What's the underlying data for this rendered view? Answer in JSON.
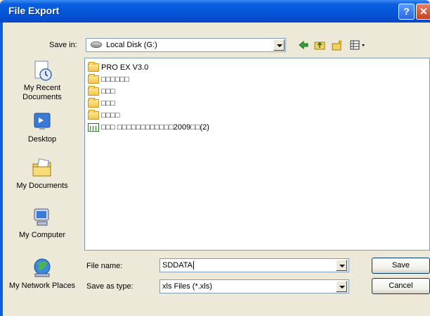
{
  "window": {
    "title": "File Export"
  },
  "toolbar": {
    "save_in_label": "Save in:",
    "location": "Local Disk (G:)"
  },
  "places": [
    {
      "label": "My Recent Documents",
      "icon": "recent-documents-icon"
    },
    {
      "label": "Desktop",
      "icon": "desktop-icon"
    },
    {
      "label": "My Documents",
      "icon": "my-documents-icon"
    },
    {
      "label": "My Computer",
      "icon": "my-computer-icon"
    },
    {
      "label": "My Network Places",
      "icon": "network-places-icon"
    }
  ],
  "files": [
    {
      "name": "PRO EX V3.0",
      "type": "folder"
    },
    {
      "name": "□□□□□□",
      "type": "folder"
    },
    {
      "name": "□□□",
      "type": "folder"
    },
    {
      "name": "□□□",
      "type": "folder"
    },
    {
      "name": "□□□□",
      "type": "folder"
    },
    {
      "name": "□□□ □□□□□□□□□□□□2009□□(2)",
      "type": "xls"
    }
  ],
  "form": {
    "file_name_label": "File name:",
    "file_name_value": "SDDATA",
    "save_type_label": "Save as type:",
    "save_type_value": "xls Files (*.xls)",
    "save_button": "Save",
    "cancel_button": "Cancel"
  },
  "colors": {
    "titlebar": "#0454d8",
    "dialog_bg": "#ece9d8",
    "field_border": "#7f9db9"
  }
}
